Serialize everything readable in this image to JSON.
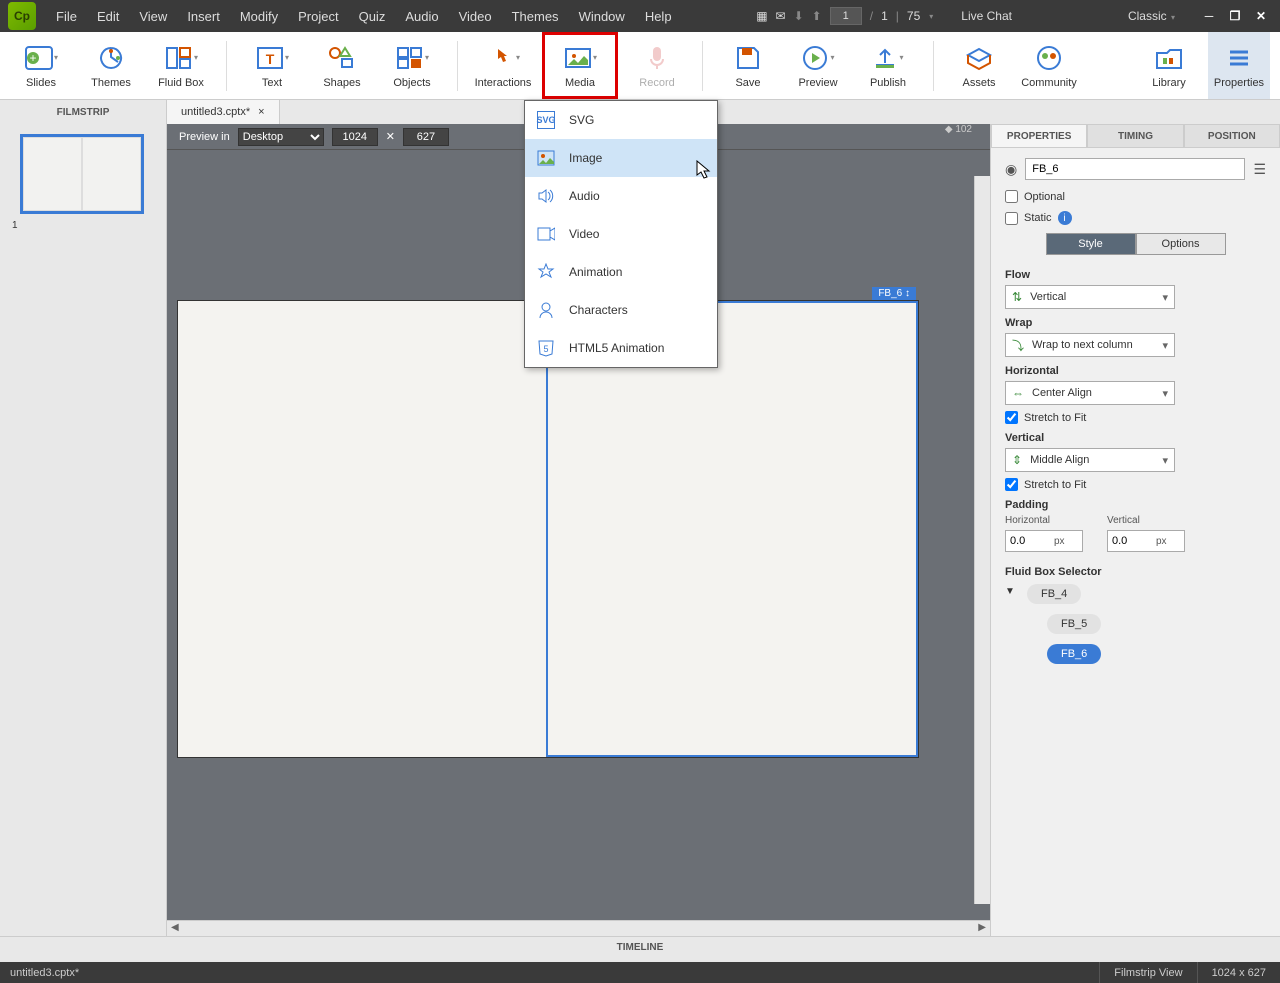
{
  "menubar": {
    "items": [
      "File",
      "Edit",
      "View",
      "Insert",
      "Modify",
      "Project",
      "Quiz",
      "Audio",
      "Video",
      "Themes",
      "Window",
      "Help"
    ],
    "page": "1",
    "total_pages": "1",
    "zoom": "75",
    "live_chat": "Live Chat",
    "workspace": "Classic"
  },
  "ribbon": {
    "items": [
      {
        "label": "Slides",
        "icon": "slides"
      },
      {
        "label": "Themes",
        "icon": "themes"
      },
      {
        "label": "Fluid Box",
        "icon": "fluidbox"
      },
      {
        "label": "Text",
        "icon": "text"
      },
      {
        "label": "Shapes",
        "icon": "shapes"
      },
      {
        "label": "Objects",
        "icon": "objects"
      },
      {
        "label": "Interactions",
        "icon": "interactions"
      },
      {
        "label": "Media",
        "icon": "media"
      },
      {
        "label": "Record",
        "icon": "record"
      },
      {
        "label": "Save",
        "icon": "save"
      },
      {
        "label": "Preview",
        "icon": "preview"
      },
      {
        "label": "Publish",
        "icon": "publish"
      },
      {
        "label": "Assets",
        "icon": "assets"
      },
      {
        "label": "Community",
        "icon": "community"
      },
      {
        "label": "Library",
        "icon": "library"
      },
      {
        "label": "Properties",
        "icon": "properties"
      }
    ]
  },
  "tabbar": {
    "filmstrip_label": "FILMSTRIP",
    "tab_name": "untitled3.cptx*",
    "close": "×"
  },
  "stage": {
    "preview_in": "Preview in",
    "device": "Desktop",
    "width": "1024",
    "height": "627",
    "ruler_val": "102",
    "selected_label": "FB_6 ↕"
  },
  "dropdown": {
    "items": [
      "SVG",
      "Image",
      "Audio",
      "Video",
      "Animation",
      "Characters",
      "HTML5 Animation"
    ]
  },
  "filmstrip": {
    "num": "1"
  },
  "props": {
    "tabs": [
      "PROPERTIES",
      "TIMING",
      "POSITION"
    ],
    "name": "FB_6",
    "optional": "Optional",
    "static": "Static",
    "sub_tabs": [
      "Style",
      "Options"
    ],
    "flow_label": "Flow",
    "flow_value": "Vertical",
    "wrap_label": "Wrap",
    "wrap_value": "Wrap to next column",
    "horizontal_label": "Horizontal",
    "horizontal_value": "Center Align",
    "stretch1": "Stretch to Fit",
    "vertical_label": "Vertical",
    "vertical_value": "Middle Align",
    "stretch2": "Stretch to Fit",
    "padding_label": "Padding",
    "pad_h_label": "Horizontal",
    "pad_v_label": "Vertical",
    "pad_h": "0.0",
    "pad_v": "0.0",
    "pad_unit": "px",
    "fbs_label": "Fluid Box Selector",
    "fbs_items": [
      "FB_4",
      "FB_5",
      "FB_6"
    ]
  },
  "timeline": {
    "label": "TIMELINE"
  },
  "statusbar": {
    "file": "untitled3.cptx*",
    "view": "Filmstrip View",
    "dims": "1024 x 627"
  }
}
